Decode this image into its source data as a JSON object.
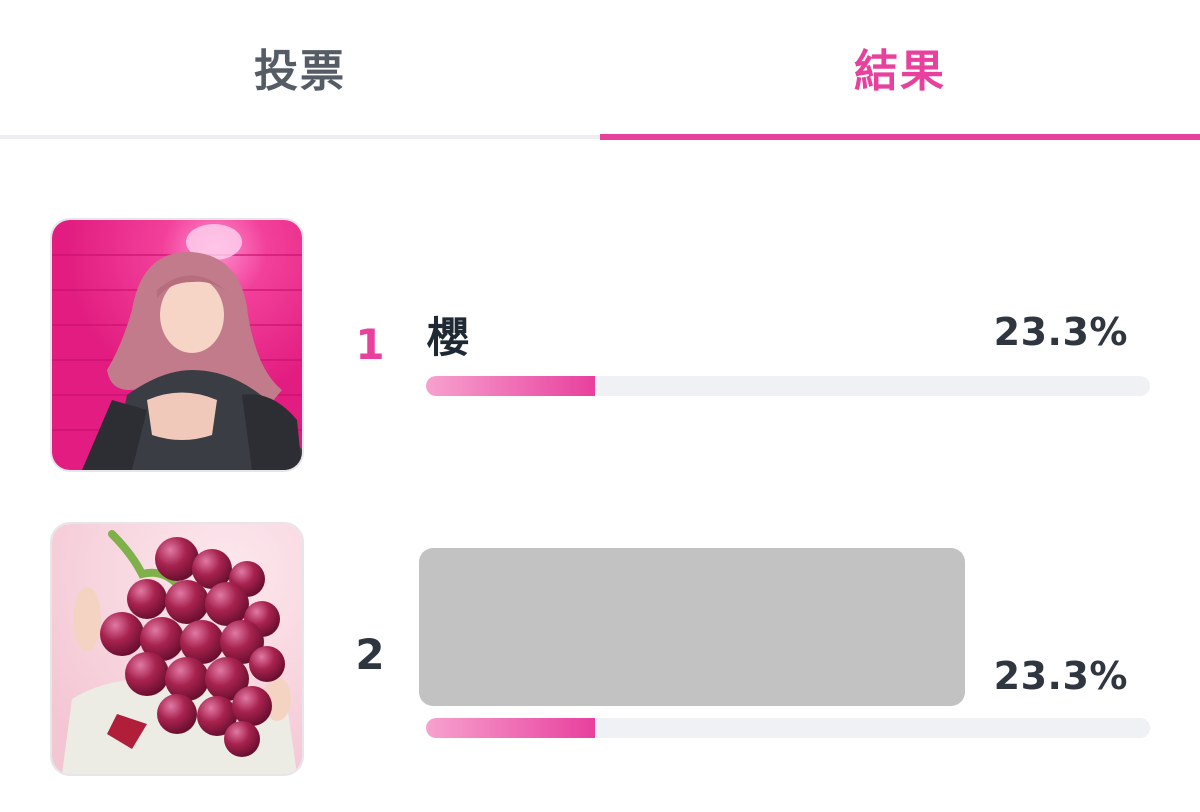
{
  "tabs": [
    {
      "label": "投票",
      "active": false
    },
    {
      "label": "結果",
      "active": true
    }
  ],
  "colors": {
    "accent": "#e8409d",
    "accent_light": "#f7a2cf",
    "tab_inactive_text": "#555c66",
    "rank_first": "#e8409d",
    "rank_other": "#2f3640",
    "bar_track": "#f0f1f4",
    "redaction": "#c2c2c2"
  },
  "results": [
    {
      "rank": "1",
      "name": "櫻",
      "percent": "23.3%",
      "share": 0.233,
      "thumbnail_icon": "member-photo-icon"
    },
    {
      "rank": "2",
      "name": "",
      "name_redacted": true,
      "percent": "23.3%",
      "share": 0.233,
      "thumbnail_icon": "grape-sticker-photo-icon"
    }
  ]
}
